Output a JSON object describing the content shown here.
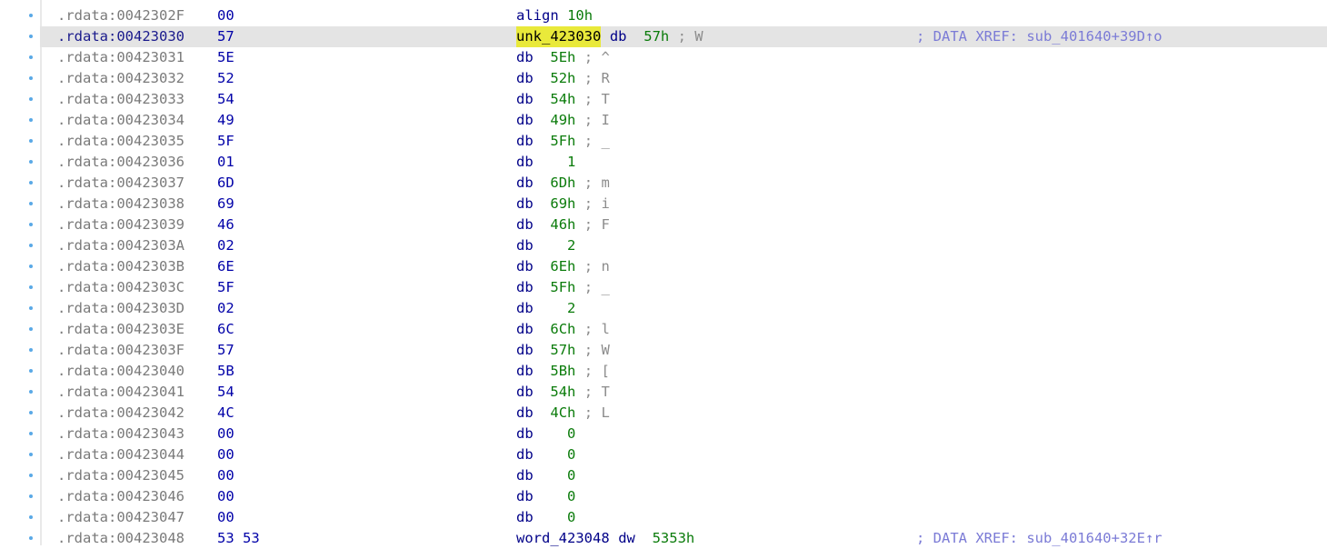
{
  "rows": [
    {
      "addr": ".rdata:0042302F",
      "bytes": "00",
      "label": "",
      "mnem": "align",
      "operand": "10h",
      "comment": "",
      "xref": ""
    },
    {
      "addr": ".rdata:00423030",
      "bytes": "57",
      "label": "unk_423030",
      "mnem": "db",
      "operand": "57h",
      "comment": "; W",
      "xref": "; DATA XREF: sub_401640+39D↑o"
    },
    {
      "addr": ".rdata:00423031",
      "bytes": "5E",
      "label": "",
      "mnem": "db",
      "operand": "5Eh",
      "comment": "; ^",
      "xref": ""
    },
    {
      "addr": ".rdata:00423032",
      "bytes": "52",
      "label": "",
      "mnem": "db",
      "operand": "52h",
      "comment": "; R",
      "xref": ""
    },
    {
      "addr": ".rdata:00423033",
      "bytes": "54",
      "label": "",
      "mnem": "db",
      "operand": "54h",
      "comment": "; T",
      "xref": ""
    },
    {
      "addr": ".rdata:00423034",
      "bytes": "49",
      "label": "",
      "mnem": "db",
      "operand": "49h",
      "comment": "; I",
      "xref": ""
    },
    {
      "addr": ".rdata:00423035",
      "bytes": "5F",
      "label": "",
      "mnem": "db",
      "operand": "5Fh",
      "comment": "; _",
      "xref": ""
    },
    {
      "addr": ".rdata:00423036",
      "bytes": "01",
      "label": "",
      "mnem": "db",
      "operand": "  1",
      "comment": "",
      "xref": ""
    },
    {
      "addr": ".rdata:00423037",
      "bytes": "6D",
      "label": "",
      "mnem": "db",
      "operand": "6Dh",
      "comment": "; m",
      "xref": ""
    },
    {
      "addr": ".rdata:00423038",
      "bytes": "69",
      "label": "",
      "mnem": "db",
      "operand": "69h",
      "comment": "; i",
      "xref": ""
    },
    {
      "addr": ".rdata:00423039",
      "bytes": "46",
      "label": "",
      "mnem": "db",
      "operand": "46h",
      "comment": "; F",
      "xref": ""
    },
    {
      "addr": ".rdata:0042303A",
      "bytes": "02",
      "label": "",
      "mnem": "db",
      "operand": "  2",
      "comment": "",
      "xref": ""
    },
    {
      "addr": ".rdata:0042303B",
      "bytes": "6E",
      "label": "",
      "mnem": "db",
      "operand": "6Eh",
      "comment": "; n",
      "xref": ""
    },
    {
      "addr": ".rdata:0042303C",
      "bytes": "5F",
      "label": "",
      "mnem": "db",
      "operand": "5Fh",
      "comment": "; _",
      "xref": ""
    },
    {
      "addr": ".rdata:0042303D",
      "bytes": "02",
      "label": "",
      "mnem": "db",
      "operand": "  2",
      "comment": "",
      "xref": ""
    },
    {
      "addr": ".rdata:0042303E",
      "bytes": "6C",
      "label": "",
      "mnem": "db",
      "operand": "6Ch",
      "comment": "; l",
      "xref": ""
    },
    {
      "addr": ".rdata:0042303F",
      "bytes": "57",
      "label": "",
      "mnem": "db",
      "operand": "57h",
      "comment": "; W",
      "xref": ""
    },
    {
      "addr": ".rdata:00423040",
      "bytes": "5B",
      "label": "",
      "mnem": "db",
      "operand": "5Bh",
      "comment": "; [",
      "xref": ""
    },
    {
      "addr": ".rdata:00423041",
      "bytes": "54",
      "label": "",
      "mnem": "db",
      "operand": "54h",
      "comment": "; T",
      "xref": ""
    },
    {
      "addr": ".rdata:00423042",
      "bytes": "4C",
      "label": "",
      "mnem": "db",
      "operand": "4Ch",
      "comment": "; L",
      "xref": ""
    },
    {
      "addr": ".rdata:00423043",
      "bytes": "00",
      "label": "",
      "mnem": "db",
      "operand": "  0",
      "comment": "",
      "xref": ""
    },
    {
      "addr": ".rdata:00423044",
      "bytes": "00",
      "label": "",
      "mnem": "db",
      "operand": "  0",
      "comment": "",
      "xref": ""
    },
    {
      "addr": ".rdata:00423045",
      "bytes": "00",
      "label": "",
      "mnem": "db",
      "operand": "  0",
      "comment": "",
      "xref": ""
    },
    {
      "addr": ".rdata:00423046",
      "bytes": "00",
      "label": "",
      "mnem": "db",
      "operand": "  0",
      "comment": "",
      "xref": ""
    },
    {
      "addr": ".rdata:00423047",
      "bytes": "00",
      "label": "",
      "mnem": "db",
      "operand": "  0",
      "comment": "",
      "xref": ""
    },
    {
      "addr": ".rdata:00423048",
      "bytes": "53 53",
      "label": "word_423048",
      "mnem": "dw",
      "operand": "5353h",
      "comment": "",
      "xref": "; DATA XREF: sub_401640+32E↑r"
    }
  ],
  "selected_row": 1,
  "highlighted_label": "unk_423030"
}
